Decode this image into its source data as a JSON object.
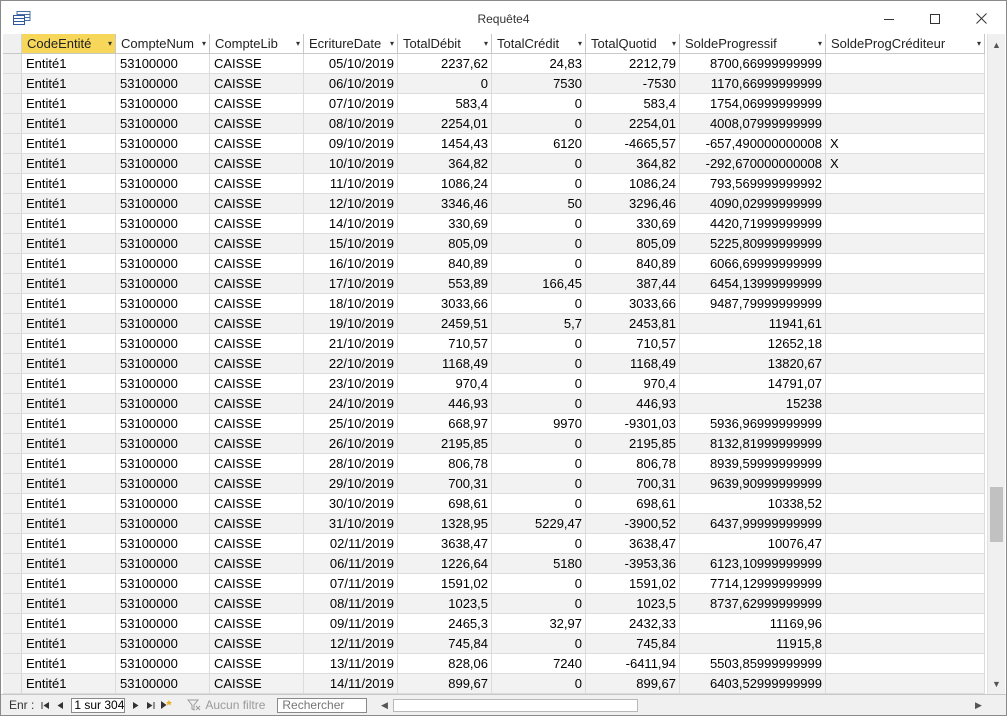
{
  "window": {
    "title": "Requête4"
  },
  "columns": [
    {
      "label": "CodeEntité",
      "active": true
    },
    {
      "label": "CompteNum",
      "active": false
    },
    {
      "label": "CompteLib",
      "active": false
    },
    {
      "label": "EcritureDate",
      "active": false
    },
    {
      "label": "TotalDébit",
      "active": false
    },
    {
      "label": "TotalCrédit",
      "active": false
    },
    {
      "label": "TotalQuotid",
      "active": false
    },
    {
      "label": "SoldeProgressif",
      "active": false
    },
    {
      "label": "SoldeProgCréditeur",
      "active": false
    }
  ],
  "rows": [
    [
      "Entité1",
      "53100000",
      "CAISSE",
      "05/10/2019",
      "2237,62",
      "24,83",
      "2212,79",
      "8700,66999999999",
      ""
    ],
    [
      "Entité1",
      "53100000",
      "CAISSE",
      "06/10/2019",
      "0",
      "7530",
      "-7530",
      "1170,66999999999",
      ""
    ],
    [
      "Entité1",
      "53100000",
      "CAISSE",
      "07/10/2019",
      "583,4",
      "0",
      "583,4",
      "1754,06999999999",
      ""
    ],
    [
      "Entité1",
      "53100000",
      "CAISSE",
      "08/10/2019",
      "2254,01",
      "0",
      "2254,01",
      "4008,07999999999",
      ""
    ],
    [
      "Entité1",
      "53100000",
      "CAISSE",
      "09/10/2019",
      "1454,43",
      "6120",
      "-4665,57",
      "-657,490000000008",
      "X"
    ],
    [
      "Entité1",
      "53100000",
      "CAISSE",
      "10/10/2019",
      "364,82",
      "0",
      "364,82",
      "-292,670000000008",
      "X"
    ],
    [
      "Entité1",
      "53100000",
      "CAISSE",
      "11/10/2019",
      "1086,24",
      "0",
      "1086,24",
      "793,569999999992",
      ""
    ],
    [
      "Entité1",
      "53100000",
      "CAISSE",
      "12/10/2019",
      "3346,46",
      "50",
      "3296,46",
      "4090,02999999999",
      ""
    ],
    [
      "Entité1",
      "53100000",
      "CAISSE",
      "14/10/2019",
      "330,69",
      "0",
      "330,69",
      "4420,71999999999",
      ""
    ],
    [
      "Entité1",
      "53100000",
      "CAISSE",
      "15/10/2019",
      "805,09",
      "0",
      "805,09",
      "5225,80999999999",
      ""
    ],
    [
      "Entité1",
      "53100000",
      "CAISSE",
      "16/10/2019",
      "840,89",
      "0",
      "840,89",
      "6066,69999999999",
      ""
    ],
    [
      "Entité1",
      "53100000",
      "CAISSE",
      "17/10/2019",
      "553,89",
      "166,45",
      "387,44",
      "6454,13999999999",
      ""
    ],
    [
      "Entité1",
      "53100000",
      "CAISSE",
      "18/10/2019",
      "3033,66",
      "0",
      "3033,66",
      "9487,79999999999",
      ""
    ],
    [
      "Entité1",
      "53100000",
      "CAISSE",
      "19/10/2019",
      "2459,51",
      "5,7",
      "2453,81",
      "11941,61",
      ""
    ],
    [
      "Entité1",
      "53100000",
      "CAISSE",
      "21/10/2019",
      "710,57",
      "0",
      "710,57",
      "12652,18",
      ""
    ],
    [
      "Entité1",
      "53100000",
      "CAISSE",
      "22/10/2019",
      "1168,49",
      "0",
      "1168,49",
      "13820,67",
      ""
    ],
    [
      "Entité1",
      "53100000",
      "CAISSE",
      "23/10/2019",
      "970,4",
      "0",
      "970,4",
      "14791,07",
      ""
    ],
    [
      "Entité1",
      "53100000",
      "CAISSE",
      "24/10/2019",
      "446,93",
      "0",
      "446,93",
      "15238",
      ""
    ],
    [
      "Entité1",
      "53100000",
      "CAISSE",
      "25/10/2019",
      "668,97",
      "9970",
      "-9301,03",
      "5936,96999999999",
      ""
    ],
    [
      "Entité1",
      "53100000",
      "CAISSE",
      "26/10/2019",
      "2195,85",
      "0",
      "2195,85",
      "8132,81999999999",
      ""
    ],
    [
      "Entité1",
      "53100000",
      "CAISSE",
      "28/10/2019",
      "806,78",
      "0",
      "806,78",
      "8939,59999999999",
      ""
    ],
    [
      "Entité1",
      "53100000",
      "CAISSE",
      "29/10/2019",
      "700,31",
      "0",
      "700,31",
      "9639,90999999999",
      ""
    ],
    [
      "Entité1",
      "53100000",
      "CAISSE",
      "30/10/2019",
      "698,61",
      "0",
      "698,61",
      "10338,52",
      ""
    ],
    [
      "Entité1",
      "53100000",
      "CAISSE",
      "31/10/2019",
      "1328,95",
      "5229,47",
      "-3900,52",
      "6437,99999999999",
      ""
    ],
    [
      "Entité1",
      "53100000",
      "CAISSE",
      "02/11/2019",
      "3638,47",
      "0",
      "3638,47",
      "10076,47",
      ""
    ],
    [
      "Entité1",
      "53100000",
      "CAISSE",
      "06/11/2019",
      "1226,64",
      "5180",
      "-3953,36",
      "6123,10999999999",
      ""
    ],
    [
      "Entité1",
      "53100000",
      "CAISSE",
      "07/11/2019",
      "1591,02",
      "0",
      "1591,02",
      "7714,12999999999",
      ""
    ],
    [
      "Entité1",
      "53100000",
      "CAISSE",
      "08/11/2019",
      "1023,5",
      "0",
      "1023,5",
      "8737,62999999999",
      ""
    ],
    [
      "Entité1",
      "53100000",
      "CAISSE",
      "09/11/2019",
      "2465,3",
      "32,97",
      "2432,33",
      "11169,96",
      ""
    ],
    [
      "Entité1",
      "53100000",
      "CAISSE",
      "12/11/2019",
      "745,84",
      "0",
      "745,84",
      "11915,8",
      ""
    ],
    [
      "Entité1",
      "53100000",
      "CAISSE",
      "13/11/2019",
      "828,06",
      "7240",
      "-6411,94",
      "5503,85999999999",
      ""
    ],
    [
      "Entité1",
      "53100000",
      "CAISSE",
      "14/11/2019",
      "899,67",
      "0",
      "899,67",
      "6403,52999999999",
      ""
    ]
  ],
  "navigation": {
    "record_label": "Enr :",
    "record_position": "1 sur 304",
    "filter_label": "Aucun filtre",
    "search_label": "Rechercher"
  },
  "colors": {
    "active_header": "#f7d75a",
    "alt_row": "#f2f2f2"
  }
}
